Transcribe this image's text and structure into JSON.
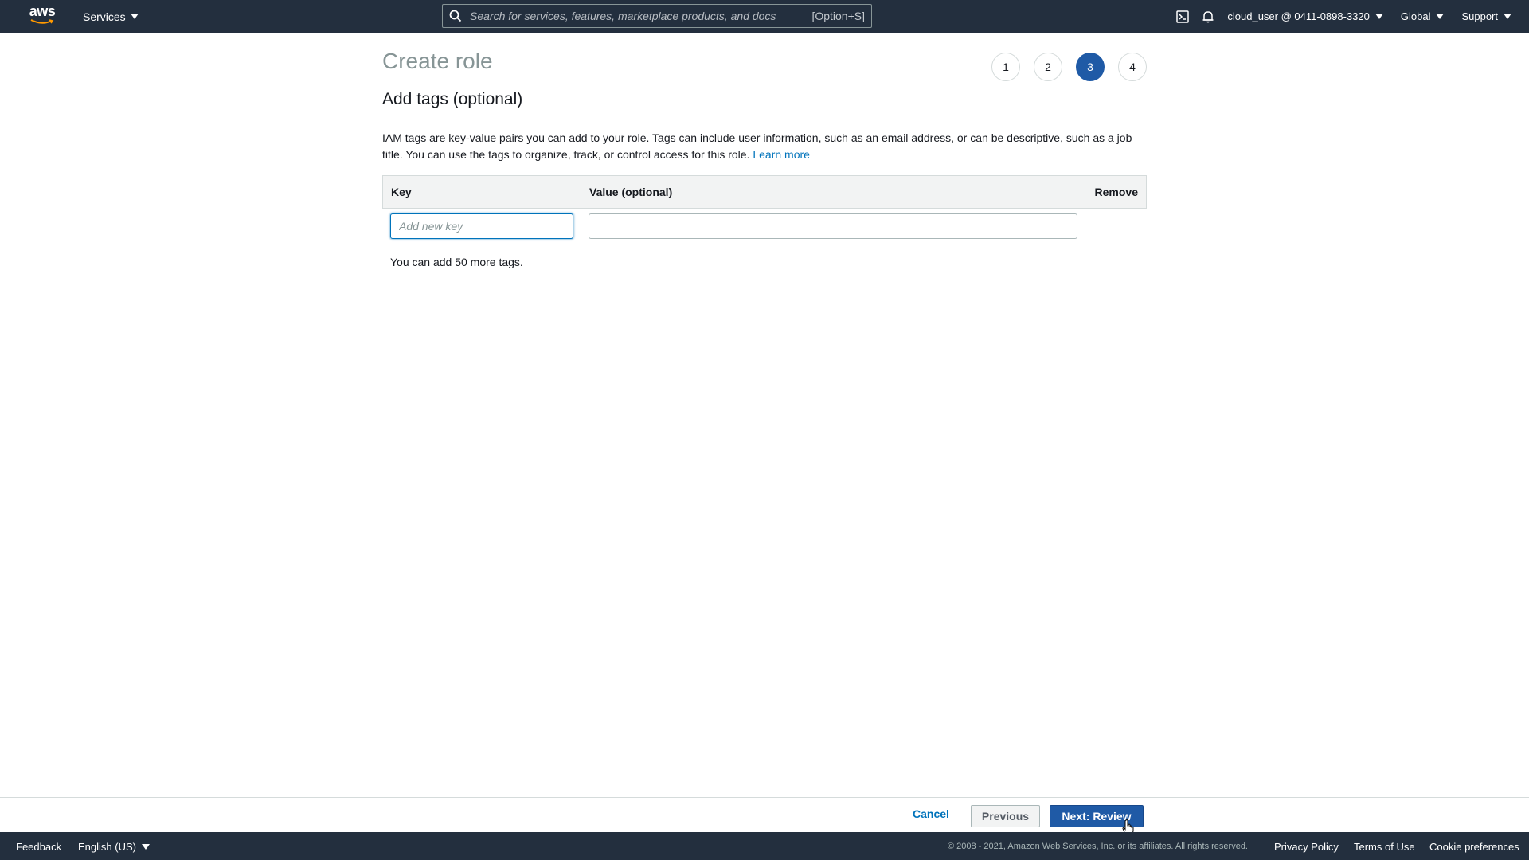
{
  "topnav": {
    "logo_text": "aws",
    "services_label": "Services",
    "search_placeholder": "Search for services, features, marketplace products, and docs",
    "search_shortcut": "[Option+S]",
    "account_label": "cloud_user @ 0411-0898-3320",
    "region_label": "Global",
    "support_label": "Support",
    "icons": [
      "cloudshell-icon",
      "bell-icon"
    ]
  },
  "page": {
    "title": "Create role",
    "steps": [
      {
        "label": "1",
        "active": false
      },
      {
        "label": "2",
        "active": false
      },
      {
        "label": "3",
        "active": true
      },
      {
        "label": "4",
        "active": false
      }
    ],
    "section_title": "Add tags (optional)",
    "description": "IAM tags are key-value pairs you can add to your role. Tags can include user information, such as an email address, or can be descriptive, such as a job title. You can use the tags to organize, track, or control access for this role.",
    "learn_more": "Learn more"
  },
  "tags_table": {
    "header_key": "Key",
    "header_value": "Value (optional)",
    "header_remove": "Remove",
    "key_placeholder": "Add new key",
    "key_value": "",
    "value_value": "",
    "remaining_text": "You can add 50 more tags."
  },
  "actions": {
    "cancel": "Cancel",
    "previous": "Previous",
    "next": "Next: Review"
  },
  "footer": {
    "feedback": "Feedback",
    "language": "English (US)",
    "copyright": "© 2008 - 2021, Amazon Web Services, Inc. or its affiliates. All rights reserved.",
    "privacy": "Privacy Policy",
    "terms": "Terms of Use",
    "cookies": "Cookie preferences"
  },
  "colors": {
    "nav_bg": "#232f3e",
    "primary_button": "#1f5aa6",
    "link": "#0073bb",
    "title_gray": "#879596"
  }
}
